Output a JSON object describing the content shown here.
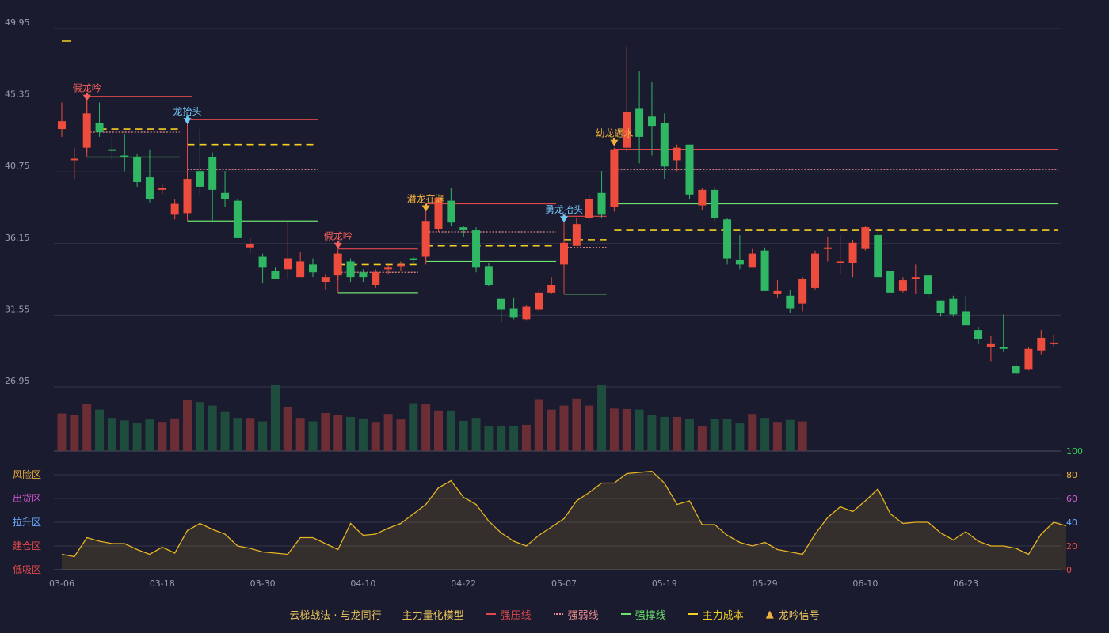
{
  "chart_data": {
    "type": "candlestick",
    "price_axis": {
      "ticks": [
        49.95,
        45.35,
        40.75,
        36.15,
        31.55,
        26.95
      ],
      "ylim": [
        26.95,
        49.95
      ]
    },
    "oscillator_axis": {
      "ticks": [
        0,
        20,
        40,
        60,
        80,
        100
      ],
      "ylim": [
        0,
        100
      ]
    },
    "zone_labels": [
      "风险区",
      "出货区",
      "拉升区",
      "建仓区",
      "低吸区"
    ],
    "x_tick_labels": [
      {
        "label": "03-06",
        "index": 0
      },
      {
        "label": "03-18",
        "index": 8
      },
      {
        "label": "03-30",
        "index": 16
      },
      {
        "label": "04-10",
        "index": 24
      },
      {
        "label": "04-22",
        "index": 32
      },
      {
        "label": "05-07",
        "index": 40
      },
      {
        "label": "05-19",
        "index": 48
      },
      {
        "label": "05-29",
        "index": 56
      },
      {
        "label": "06-10",
        "index": 64
      },
      {
        "label": "06-23",
        "index": 72
      }
    ],
    "candles": [
      [
        43.5,
        44.0,
        43.0,
        45.2
      ],
      [
        41.5,
        41.6,
        40.3,
        42.3
      ],
      [
        42.3,
        44.5,
        42.0,
        45.3
      ],
      [
        43.9,
        43.3,
        43.0,
        45.2
      ],
      [
        42.2,
        42.1,
        41.5,
        43.0
      ],
      [
        41.8,
        41.7,
        40.8,
        43.2
      ],
      [
        41.7,
        40.1,
        39.8,
        41.9
      ],
      [
        40.4,
        39.0,
        38.8,
        42.2
      ],
      [
        39.7,
        39.7,
        39.3,
        40.0
      ],
      [
        38.0,
        38.7,
        37.7,
        39.0
      ],
      [
        38.1,
        40.3,
        37.8,
        40.8
      ],
      [
        40.8,
        39.8,
        39.3,
        43.5
      ],
      [
        41.7,
        39.6,
        37.5,
        42.0
      ],
      [
        39.4,
        39.0,
        38.5,
        40.8
      ],
      [
        38.9,
        36.5,
        36.5,
        39.0
      ],
      [
        35.9,
        36.1,
        35.5,
        36.5
      ],
      [
        35.3,
        34.6,
        33.6,
        35.5
      ],
      [
        34.4,
        33.9,
        33.9,
        34.6
      ],
      [
        34.5,
        35.2,
        33.9,
        37.6
      ],
      [
        34.0,
        35.0,
        34.0,
        35.6
      ],
      [
        34.8,
        34.3,
        34.0,
        35.2
      ],
      [
        33.7,
        34.0,
        33.2,
        34.2
      ],
      [
        34.1,
        35.5,
        33.8,
        35.6
      ],
      [
        35.0,
        34.0,
        33.7,
        35.2
      ],
      [
        34.3,
        34.0,
        33.7,
        34.5
      ],
      [
        33.5,
        34.3,
        33.3,
        34.5
      ],
      [
        34.6,
        34.6,
        34.2,
        34.8
      ],
      [
        34.7,
        34.8,
        34.4,
        35.0
      ],
      [
        35.2,
        35.1,
        34.8,
        35.3
      ],
      [
        35.3,
        37.6,
        34.8,
        37.6
      ],
      [
        37.1,
        39.1,
        36.9,
        39.1
      ],
      [
        38.9,
        37.5,
        37.3,
        39.7
      ],
      [
        37.2,
        37.0,
        36.6,
        37.3
      ],
      [
        37.0,
        34.6,
        34.3,
        37.2
      ],
      [
        34.7,
        33.5,
        33.4,
        34.9
      ],
      [
        32.6,
        31.9,
        31.1,
        32.7
      ],
      [
        32.0,
        31.4,
        31.3,
        32.7
      ],
      [
        31.3,
        32.1,
        31.2,
        32.2
      ],
      [
        31.9,
        33.0,
        31.8,
        33.2
      ],
      [
        33.0,
        33.5,
        32.9,
        34.0
      ],
      [
        34.8,
        36.2,
        34.6,
        36.8
      ],
      [
        36.0,
        37.4,
        36.0,
        37.8
      ],
      [
        37.8,
        39.0,
        37.7,
        39.3
      ],
      [
        39.4,
        38.0,
        37.8,
        40.8
      ],
      [
        38.5,
        42.2,
        38.2,
        42.3
      ],
      [
        42.3,
        44.6,
        42.0,
        48.8
      ],
      [
        44.8,
        43.0,
        41.3,
        47.2
      ],
      [
        44.3,
        43.7,
        41.8,
        46.5
      ],
      [
        43.9,
        41.1,
        40.3,
        44.5
      ],
      [
        41.5,
        42.3,
        40.8,
        42.5
      ],
      [
        42.5,
        39.3,
        39.0,
        42.5
      ],
      [
        38.6,
        39.6,
        38.3,
        39.7
      ],
      [
        39.6,
        37.8,
        37.6,
        39.8
      ],
      [
        37.7,
        35.2,
        34.8,
        37.8
      ],
      [
        35.1,
        34.8,
        34.5,
        36.7
      ],
      [
        34.6,
        35.5,
        34.6,
        35.8
      ],
      [
        35.7,
        33.1,
        33.1,
        35.9
      ],
      [
        32.9,
        33.1,
        32.7,
        33.8
      ],
      [
        32.8,
        32.0,
        31.7,
        33.2
      ],
      [
        32.3,
        33.9,
        31.8,
        34.0
      ],
      [
        33.3,
        35.5,
        33.2,
        35.7
      ],
      [
        35.9,
        35.9,
        35.0,
        36.6
      ],
      [
        34.9,
        35.0,
        34.2,
        36.7
      ],
      [
        34.9,
        36.2,
        34.0,
        36.4
      ],
      [
        35.8,
        37.2,
        35.7,
        37.3
      ],
      [
        36.7,
        34.0,
        34.0,
        36.8
      ],
      [
        34.4,
        33.0,
        33.0,
        34.4
      ],
      [
        33.1,
        33.8,
        33.0,
        34.0
      ],
      [
        33.9,
        34.0,
        32.9,
        34.8
      ],
      [
        34.1,
        32.9,
        32.7,
        34.2
      ],
      [
        32.5,
        31.7,
        31.5,
        32.5
      ],
      [
        32.6,
        31.6,
        31.5,
        32.8
      ],
      [
        31.8,
        30.9,
        30.9,
        32.8
      ],
      [
        30.6,
        30.0,
        29.7,
        30.8
      ],
      [
        29.5,
        29.7,
        28.6,
        30.2
      ],
      [
        29.5,
        29.4,
        29.2,
        31.6
      ],
      [
        28.3,
        27.8,
        27.7,
        28.7
      ],
      [
        28.1,
        29.4,
        28.0,
        29.5
      ],
      [
        29.3,
        30.1,
        29.0,
        30.6
      ],
      [
        29.7,
        29.8,
        29.5,
        30.3
      ]
    ],
    "volume": [
      76,
      73,
      96,
      84,
      67,
      62,
      57,
      64,
      59,
      66,
      104,
      99,
      92,
      79,
      67,
      67,
      60,
      133,
      89,
      67,
      60,
      77,
      73,
      69,
      66,
      59,
      75,
      64,
      97,
      96,
      82,
      82,
      61,
      67,
      50,
      51,
      51,
      53,
      105,
      84,
      92,
      106,
      92,
      133,
      86,
      85,
      84,
      73,
      69,
      69,
      65,
      50,
      65,
      65,
      56,
      75,
      67,
      59,
      63,
      60
    ],
    "oscillator": [
      13,
      11,
      27,
      24,
      22,
      22,
      17,
      13,
      19,
      14,
      33,
      39,
      34,
      30,
      20,
      18,
      15,
      14,
      13,
      27,
      27,
      22,
      17,
      39,
      29,
      30,
      35,
      39,
      47,
      55,
      69,
      75,
      61,
      55,
      41,
      31,
      24,
      20,
      29,
      36,
      43,
      58,
      65,
      73,
      73,
      81,
      82,
      83,
      73,
      55,
      58,
      38,
      38,
      29,
      23,
      20,
      23,
      17,
      15,
      13,
      30,
      44,
      53,
      49,
      58,
      68,
      47,
      39,
      40,
      40,
      31,
      25,
      32,
      24,
      20,
      20,
      18,
      13,
      30,
      40,
      37
    ],
    "annotations": [
      {
        "text": "假龙吟",
        "index": 2,
        "price": 45.4,
        "color": "#f5605a"
      },
      {
        "text": "龙抬头",
        "index": 10,
        "price": 43.9,
        "color": "#74c6f5"
      },
      {
        "text": "假龙吟",
        "index": 22,
        "price": 35.9,
        "color": "#f5605a"
      },
      {
        "text": "潜龙在渊",
        "index": 29,
        "price": 38.3,
        "color": "#f0b13a"
      },
      {
        "text": "勇龙抬头",
        "index": 40,
        "price": 37.6,
        "color": "#74c6f5"
      },
      {
        "text": "幼龙遇水",
        "index": 44,
        "price": 42.5,
        "color": "#f0b13a"
      }
    ],
    "levels": [
      {
        "kind": "strong_pressure",
        "color": "#e0474c",
        "from": 2,
        "to": 10,
        "value": 45.6,
        "style": "solid"
      },
      {
        "kind": "weak",
        "color": "#e88b8b",
        "from": 2,
        "to": 9,
        "value": 43.3,
        "style": "dotted"
      },
      {
        "kind": "main_cost",
        "color": "#f5d020",
        "from": 3,
        "to": 9,
        "value": 43.5,
        "style": "dashed"
      },
      {
        "kind": "strong_support",
        "color": "#6de26d",
        "from": 2,
        "to": 9,
        "value": 41.7,
        "style": "solid"
      },
      {
        "kind": "strong_pressure",
        "color": "#e0474c",
        "from": 10,
        "to": 20,
        "value": 44.1,
        "style": "solid"
      },
      {
        "kind": "main_cost",
        "color": "#f5d020",
        "from": 10,
        "to": 20,
        "value": 42.5,
        "style": "dashed"
      },
      {
        "kind": "weak",
        "color": "#e88b8b",
        "from": 10,
        "to": 20,
        "value": 40.9,
        "style": "dotted"
      },
      {
        "kind": "strong_support",
        "color": "#6de26d",
        "from": 10,
        "to": 20,
        "value": 37.6,
        "style": "solid"
      },
      {
        "kind": "strong_pressure",
        "color": "#e0474c",
        "from": 22,
        "to": 28,
        "value": 35.8,
        "style": "solid"
      },
      {
        "kind": "main_cost",
        "color": "#f5d020",
        "from": 22,
        "to": 28,
        "value": 34.8,
        "style": "dashed"
      },
      {
        "kind": "weak",
        "color": "#e88b8b",
        "from": 22,
        "to": 28,
        "value": 34.3,
        "style": "dotted"
      },
      {
        "kind": "strong_support",
        "color": "#6de26d",
        "from": 22,
        "to": 28,
        "value": 33.0,
        "style": "solid"
      },
      {
        "kind": "strong_pressure",
        "color": "#e0474c",
        "from": 29,
        "to": 39,
        "value": 38.7,
        "style": "solid"
      },
      {
        "kind": "weak",
        "color": "#e88b8b",
        "from": 29,
        "to": 39,
        "value": 36.9,
        "style": "dotted"
      },
      {
        "kind": "main_cost",
        "color": "#f5d020",
        "from": 29,
        "to": 39,
        "value": 36.0,
        "style": "dashed"
      },
      {
        "kind": "strong_support",
        "color": "#6de26d",
        "from": 29,
        "to": 39,
        "value": 35.0,
        "style": "solid"
      },
      {
        "kind": "strong_pressure",
        "color": "#e0474c",
        "from": 40,
        "to": 43,
        "value": 37.9,
        "style": "solid"
      },
      {
        "kind": "main_cost",
        "color": "#f5d020",
        "from": 40,
        "to": 43,
        "value": 36.4,
        "style": "dashed"
      },
      {
        "kind": "weak",
        "color": "#e88b8b",
        "from": 40,
        "to": 43,
        "value": 35.9,
        "style": "dotted"
      },
      {
        "kind": "strong_support",
        "color": "#6de26d",
        "from": 40,
        "to": 43,
        "value": 32.9,
        "style": "solid"
      },
      {
        "kind": "strong_pressure",
        "color": "#e0474c",
        "from": 44,
        "to": 79,
        "value": 42.2,
        "style": "solid"
      },
      {
        "kind": "weak",
        "color": "#e88b8b",
        "from": 44,
        "to": 79,
        "value": 40.9,
        "style": "dotted"
      },
      {
        "kind": "strong_support",
        "color": "#6de26d",
        "from": 44,
        "to": 79,
        "value": 38.7,
        "style": "solid"
      },
      {
        "kind": "main_cost",
        "color": "#f5d020",
        "from": 44,
        "to": 79,
        "value": 37.0,
        "style": "dashed"
      }
    ],
    "colors": {
      "up": "#ee4c3c",
      "down": "#2fb764",
      "vol_up": "#6b2e35",
      "vol_down": "#1e4d3d",
      "oscillator": "#e6b422",
      "grid": "#34364a"
    }
  },
  "legend": {
    "title": "云梯战法 · 与龙同行——主力量化模型",
    "items": [
      {
        "label": "强压线",
        "color": "#e0474c",
        "style": "solid"
      },
      {
        "label": "强弱线",
        "color": "#e88b8b",
        "style": "dotted"
      },
      {
        "label": "强撑线",
        "color": "#6de26d",
        "style": "solid"
      },
      {
        "label": "主力成本",
        "color": "#f5d020",
        "style": "dashed"
      },
      {
        "label": "龙吟信号",
        "color": "#f0b13a",
        "style": "triangle"
      }
    ]
  }
}
